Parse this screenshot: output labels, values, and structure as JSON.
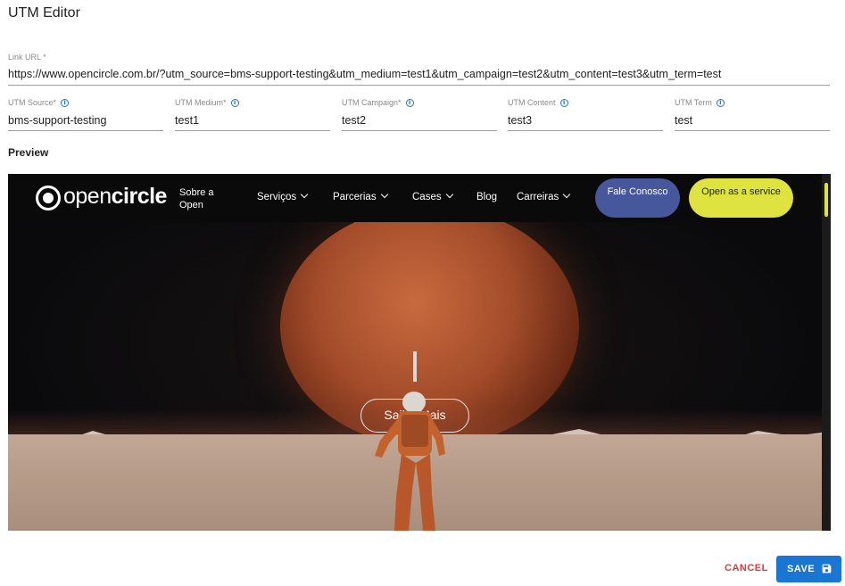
{
  "dialog": {
    "title": "UTM Editor"
  },
  "link_url": {
    "label": "Link URL *",
    "value": "https://www.opencircle.com.br/?utm_source=bms-support-testing&utm_medium=test1&utm_campaign=test2&utm_content=test3&utm_term=test"
  },
  "utm_fields": [
    {
      "label": "UTM Source*",
      "value": "bms-support-testing"
    },
    {
      "label": "UTM Medium*",
      "value": "test1"
    },
    {
      "label": "UTM Campaign*",
      "value": "test2"
    },
    {
      "label": "UTM Content",
      "value": "test3"
    },
    {
      "label": "UTM Term",
      "value": "test"
    }
  ],
  "preview": {
    "label": "Preview",
    "site": {
      "logo_light": "open",
      "logo_bold": "circle",
      "nav_sobre": "Sobre a Open",
      "nav_items": [
        "Serviços",
        "Parcerias",
        "Cases",
        "Blog",
        "Carreiras"
      ],
      "btn_fale": "Fale Conosco",
      "btn_open": "Open as a service",
      "hero_button": "Saiba Mais"
    }
  },
  "actions": {
    "cancel": "CANCEL",
    "save": "SAVE"
  },
  "colors": {
    "primary": "#1976d2",
    "danger": "#e53935",
    "accent_yellow": "#dfe33f",
    "accent_blue": "#46579c"
  },
  "icons": {
    "info": "info-circle-icon",
    "save": "floppy-disk-icon",
    "chevron": "chevron-down-icon"
  }
}
